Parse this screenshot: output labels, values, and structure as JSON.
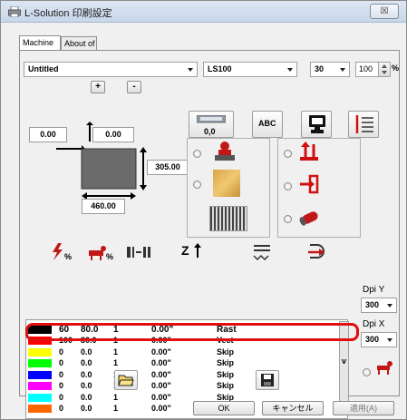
{
  "window": {
    "title": "L-Solution 印刷設定",
    "close_label": "☒"
  },
  "tabs": [
    {
      "label": "Machine"
    },
    {
      "label": "About of"
    }
  ],
  "top_row": {
    "file_value": "Untitled",
    "machine_value": "LS100",
    "speed_value": "30",
    "power_value": "100",
    "power_unit": "%"
  },
  "position_buttons": {
    "plus": "+",
    "minus": "-"
  },
  "dimensions": {
    "x_offset": "0.00",
    "y_offset": "0.00",
    "height": "305.00",
    "width": "460.00"
  },
  "tools": {
    "scale_value": "0,0",
    "abc_label": "ABC"
  },
  "columns": {
    "power_icon": "power-icon",
    "speed_icon": "speed-icon",
    "ppi_icon": "ppi-icon",
    "z_label": "Z",
    "mode_icon": "mode-icon",
    "passes_icon": "passes-icon"
  },
  "pens": [
    {
      "color": "#000000",
      "power": "60",
      "speed": "80.0",
      "passes": "1",
      "z": "0.00\"",
      "mode": "Rast"
    },
    {
      "color": "#ff0000",
      "power": "100",
      "speed": "30.0",
      "passes": "1",
      "z": "0.00\"",
      "mode": "Vect"
    },
    {
      "color": "#ffff00",
      "power": "0",
      "speed": "0.0",
      "passes": "1",
      "z": "0.00\"",
      "mode": "Skip"
    },
    {
      "color": "#00ff00",
      "power": "0",
      "speed": "0.0",
      "passes": "1",
      "z": "0.00\"",
      "mode": "Skip"
    },
    {
      "color": "#0000ff",
      "power": "0",
      "speed": "0.0",
      "passes": "1",
      "z": "0.00\"",
      "mode": "Skip"
    },
    {
      "color": "#ff00ff",
      "power": "0",
      "speed": "0.0",
      "passes": "1",
      "z": "0.00\"",
      "mode": "Skip"
    },
    {
      "color": "#00ffff",
      "power": "0",
      "speed": "0.0",
      "passes": "1",
      "z": "0.00\"",
      "mode": "Skip"
    },
    {
      "color": "#ff6600",
      "power": "0",
      "speed": "0.0",
      "passes": "1",
      "z": "0.00\"",
      "mode": "Skip"
    }
  ],
  "dpi": {
    "y_label": "Dpi Y",
    "y_value": "300",
    "x_label": "Dpi X",
    "x_value": "300"
  },
  "scroll_label": "v",
  "footer": {
    "ok": "OK",
    "cancel": "キャンセル",
    "apply": "適用(A)"
  },
  "colors": {
    "highlight": "#e01010"
  }
}
